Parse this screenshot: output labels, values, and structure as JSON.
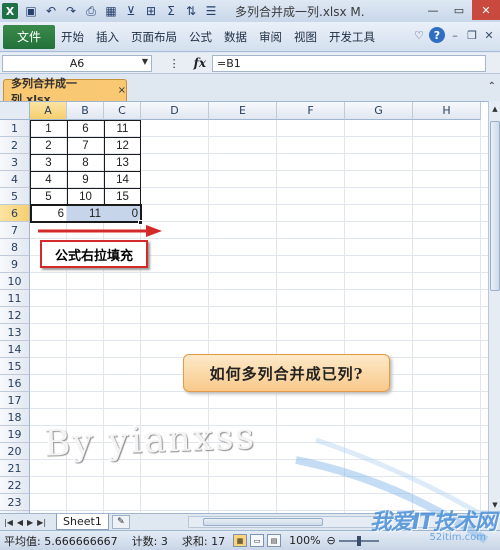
{
  "window": {
    "title": "多列合并成一列.xlsx M.",
    "app_icon": "excel-icon"
  },
  "quick_access": {
    "icons": [
      "save-icon",
      "undo-icon",
      "redo-icon",
      "print-preview-icon",
      "layout-icon",
      "filter-icon",
      "borders-icon",
      "autosum-icon",
      "sort-icon",
      "align-icon"
    ],
    "sigma": "Σ"
  },
  "ribbon": {
    "file_label": "文件",
    "tabs": [
      "开始",
      "插入",
      "页面布局",
      "公式",
      "数据",
      "审阅",
      "视图",
      "开发工具"
    ]
  },
  "formula_bar": {
    "cell_ref": "A6",
    "fx_label": "fx",
    "formula": "=B1"
  },
  "workbook_tab": {
    "label": "多列合并成一列.xlsx",
    "close": "×"
  },
  "columns": [
    "A",
    "B",
    "C",
    "D",
    "E",
    "F",
    "G",
    "H"
  ],
  "rows": [
    "1",
    "2",
    "3",
    "4",
    "5",
    "6",
    "7",
    "8",
    "9",
    "10",
    "11",
    "12",
    "13",
    "14",
    "15",
    "16",
    "17",
    "18",
    "19",
    "20",
    "21",
    "22",
    "23",
    "24"
  ],
  "cells": {
    "A": [
      "1",
      "2",
      "3",
      "4",
      "5"
    ],
    "B": [
      "6",
      "7",
      "8",
      "9",
      "10"
    ],
    "C": [
      "11",
      "12",
      "13",
      "14",
      "15"
    ],
    "row6": [
      "6",
      "11",
      "0"
    ]
  },
  "callouts": {
    "fill_right": "公式右拉填充",
    "question": "如何多列合并成已列?"
  },
  "watermark": "By yianxss",
  "sheet_tabs": {
    "active": "Sheet1"
  },
  "status_bar": {
    "average": "平均值: 5.666666667",
    "count": "计数: 3",
    "sum": "求和: 17",
    "zoom": "100%"
  },
  "brand": {
    "name": "我爱IT技术网",
    "url": "52itim.com"
  },
  "colors": {
    "selected_header": "#f6cf6f",
    "selection_fill": "#c6d5ea",
    "callout_red_border": "#d42a2a",
    "callout_orange": "#f8c98a",
    "file_tab": "#21713a"
  }
}
